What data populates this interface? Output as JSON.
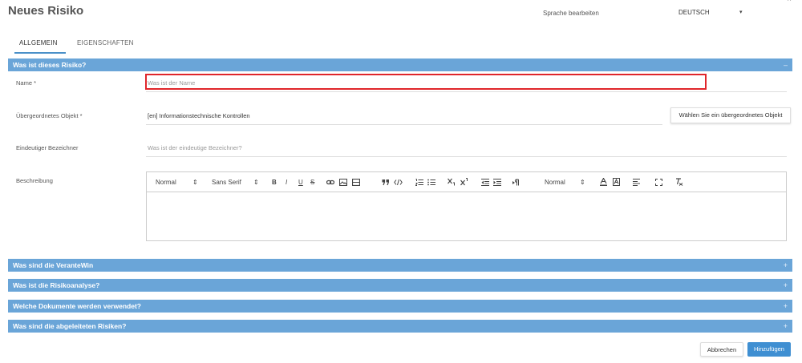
{
  "header": {
    "title": "Neues Risiko",
    "language_label": "Sprache bearbeiten",
    "language_value": "DEUTSCH",
    "caret": "▾",
    "close": "^"
  },
  "tabs": [
    {
      "label": "ALLGEMEIN",
      "active": true
    },
    {
      "label": "EIGENSCHAFTEN",
      "active": false
    }
  ],
  "general_section": {
    "title": "Was ist dieses Risiko?",
    "toggle": "–"
  },
  "fields": {
    "name": {
      "label": "Name *",
      "placeholder": "Was ist der Name",
      "value": ""
    },
    "parent": {
      "label": "Übergeordnetes Objekt *",
      "value": "[en] Informationstechnische Kontrollen",
      "button": "Wählen Sie ein übergeordnetes Objekt"
    },
    "identifier": {
      "label": "Eindeutiger Bezeichner",
      "placeholder": "Was ist der eindeutige Bezeichner?",
      "value": ""
    },
    "description": {
      "label": "Beschreibung",
      "value": ""
    }
  },
  "editor_toolbar": {
    "header_select": "Normal",
    "font_select": "Sans Serif",
    "bold": "B",
    "italic": "I",
    "underline": "U",
    "strike": "S",
    "size_select": "Normal",
    "select_arrow": "⇕"
  },
  "sections": [
    {
      "title": "Was sind die VeranteWin",
      "toggle": "+"
    },
    {
      "title": "Was ist die Risikoanalyse?",
      "toggle": "+"
    },
    {
      "title": "Welche Dokumente werden verwendet?",
      "toggle": "+"
    },
    {
      "title": "Was sind die abgeleiteten Risiken?",
      "toggle": "+"
    }
  ],
  "footer": {
    "cancel": "Abbrechen",
    "submit": "Hinzufügen"
  },
  "colors": {
    "section_bar": "#6aa5d8",
    "primary_button": "#3f8fd2",
    "tab_indicator": "#4a90c8",
    "focus_outline": "#e0262b"
  }
}
